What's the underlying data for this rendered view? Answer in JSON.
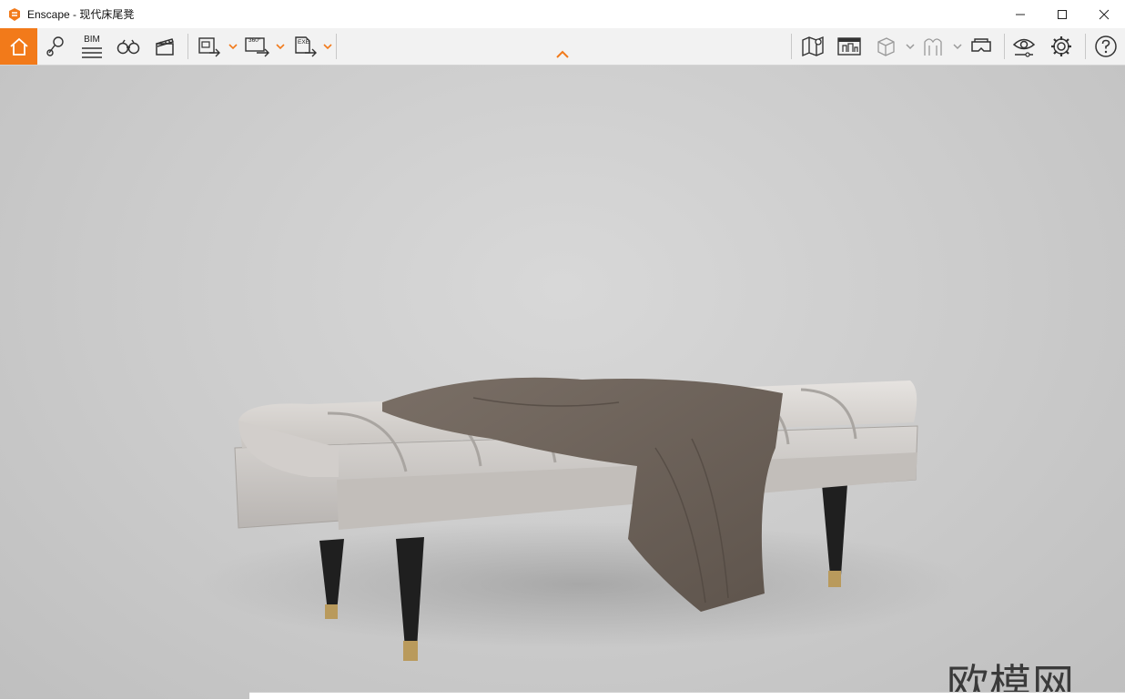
{
  "window": {
    "title": "Enscape - 现代床尾凳",
    "minimize_icon": "minimize-icon",
    "maximize_icon": "maximize-icon",
    "close_icon": "close-icon"
  },
  "toolbar": {
    "bim_label": "BIM",
    "panorama_label": "360°",
    "exe_label": "EXE",
    "accent_color": "#f27a1a",
    "icons": [
      "home-icon",
      "location-icon",
      "bim-icon",
      "binoculars-icon",
      "clapper-icon",
      "screenshot-export-icon",
      "panorama-export-icon",
      "exe-export-icon",
      "map-icon",
      "asset-library-icon",
      "cube-icon",
      "arch-icon",
      "vr-headset-icon",
      "eye-icon",
      "settings-icon",
      "help-icon"
    ]
  },
  "viewport": {
    "watermark_large": "欧模网",
    "object": "bench-with-throw"
  }
}
